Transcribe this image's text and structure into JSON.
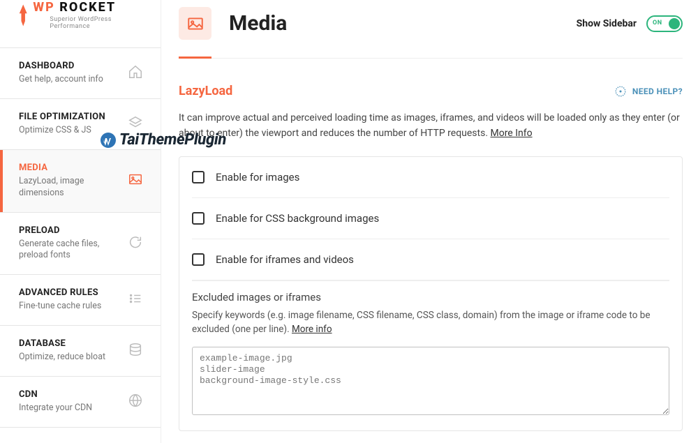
{
  "brand": {
    "wp": "WP",
    "rocket": "ROCKET",
    "tagline": "Superior WordPress Performance"
  },
  "nav": [
    {
      "title": "DASHBOARD",
      "desc": "Get help, account info",
      "icon": "home"
    },
    {
      "title": "FILE OPTIMIZATION",
      "desc": "Optimize CSS & JS",
      "icon": "layers"
    },
    {
      "title": "MEDIA",
      "desc": "LazyLoad, image dimensions",
      "icon": "image",
      "active": true
    },
    {
      "title": "PRELOAD",
      "desc": "Generate cache files, preload fonts",
      "icon": "refresh"
    },
    {
      "title": "ADVANCED RULES",
      "desc": "Fine-tune cache rules",
      "icon": "list"
    },
    {
      "title": "DATABASE",
      "desc": "Optimize, reduce bloat",
      "icon": "database"
    },
    {
      "title": "CDN",
      "desc": "Integrate your CDN",
      "icon": "globe"
    }
  ],
  "header": {
    "title": "Media",
    "show_sidebar": "Show Sidebar",
    "toggle_state": "ON"
  },
  "lazyload": {
    "title": "LazyLoad",
    "need_help": "NEED HELP?",
    "desc_a": "It can improve actual and perceived loading time as images, iframes, and videos will be loaded only as they enter (or about to enter) the viewport and reduces the number of HTTP requests. ",
    "more_info": "More Info",
    "options": [
      "Enable for images",
      "Enable for CSS background images",
      "Enable for iframes and videos"
    ],
    "excluded": {
      "title": "Excluded images or iframes",
      "desc_a": "Specify keywords (e.g. image filename, CSS filename, CSS class, domain) from the image or iframe code to be excluded (one per line). ",
      "more_info": "More info",
      "placeholder": "example-image.jpg\nslider-image\nbackground-image-style.css"
    }
  },
  "watermark": "TaiThemePlugin"
}
